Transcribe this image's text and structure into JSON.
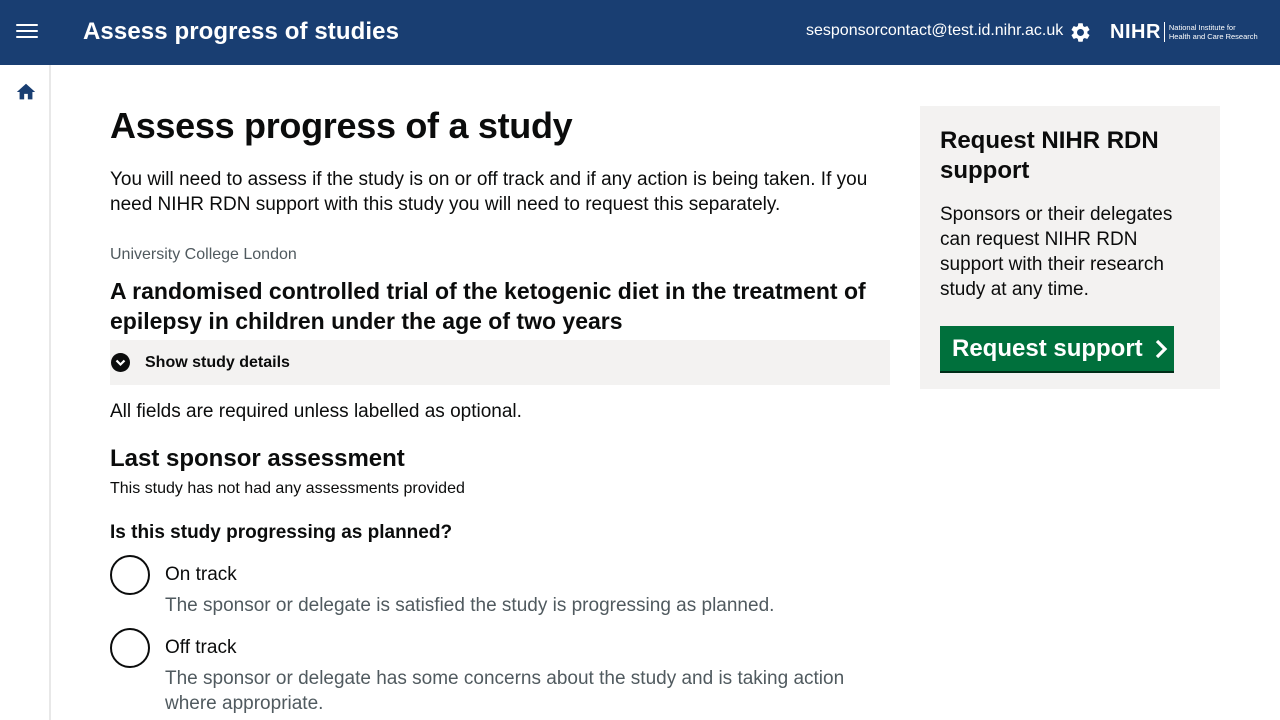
{
  "header": {
    "app_title": "Assess progress of studies",
    "user_email": "sesponsorcontact@test.id.nihr.ac.uk",
    "logo_text": "NIHR",
    "logo_subtitle_line1": "National Institute for",
    "logo_subtitle_line2": "Health and Care Research",
    "icons": [
      "menu-icon",
      "gear-icon"
    ]
  },
  "side_nav": {
    "icons": [
      "home-icon"
    ]
  },
  "main": {
    "page_title": "Assess progress of a study",
    "intro": "You will need to assess if the study is on or off track and if any action is being taken. If you need NIHR RDN support with this study you will need to request this separately.",
    "organisation": "University College London",
    "study_title": "A randomised controlled trial of the ketogenic diet in the treatment of epilepsy in children under the age of two years",
    "details_toggle_label": "Show study details",
    "required_note": "All fields are required unless labelled as optional.",
    "last_assessment": {
      "heading": "Last sponsor assessment",
      "text": "This study has not had any assessments provided"
    },
    "question": "Is this study progressing as planned?",
    "options": [
      {
        "label": "On track",
        "hint": "The sponsor or delegate is satisfied the study is progressing as planned."
      },
      {
        "label": "Off track",
        "hint": "The sponsor or delegate has some concerns about the study and is taking action where appropriate."
      }
    ]
  },
  "aside": {
    "title": "Request NIHR RDN support",
    "text": "Sponsors or their delegates can request NIHR RDN support with their research study at any time.",
    "button_label": "Request support"
  },
  "colors": {
    "header_bg": "#193e72",
    "button_green": "#00703c",
    "panel_grey": "#f3f2f1"
  }
}
